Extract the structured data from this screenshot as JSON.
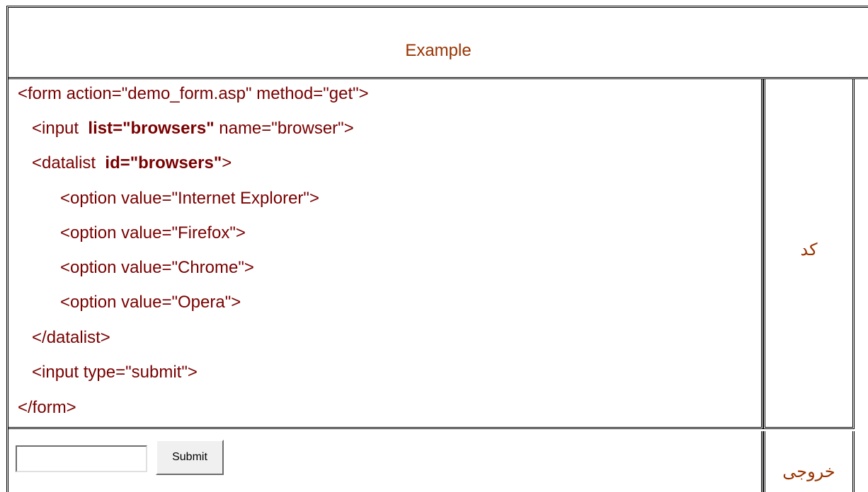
{
  "header": {
    "title": "Example"
  },
  "code": {
    "lines": [
      {
        "parts": [
          "<form action=\"demo_form.asp\" method=\"get\">"
        ]
      },
      {
        "parts": [
          "   <input  ",
          "list=\"browsers\"",
          " name=\"browser\">"
        ]
      },
      {
        "parts": [
          "   <datalist  ",
          "id=\"browsers\"",
          ">"
        ]
      },
      {
        "parts": [
          "         <option value=\"Internet Explorer\">"
        ]
      },
      {
        "parts": [
          "         <option value=\"Firefox\">"
        ]
      },
      {
        "parts": [
          "         <option value=\"Chrome\">"
        ]
      },
      {
        "parts": [
          "         <option value=\"Opera\">"
        ]
      },
      {
        "parts": [
          "   </datalist>"
        ]
      },
      {
        "parts": [
          "   <input type=\"submit\">"
        ]
      },
      {
        "parts": [
          "</form>"
        ]
      }
    ]
  },
  "labels": {
    "code": "کد",
    "output": "خروجی"
  },
  "output": {
    "input_value": "",
    "submit_label": "Submit"
  },
  "colors": {
    "title": "#993300",
    "code_text": "#7a0000"
  }
}
